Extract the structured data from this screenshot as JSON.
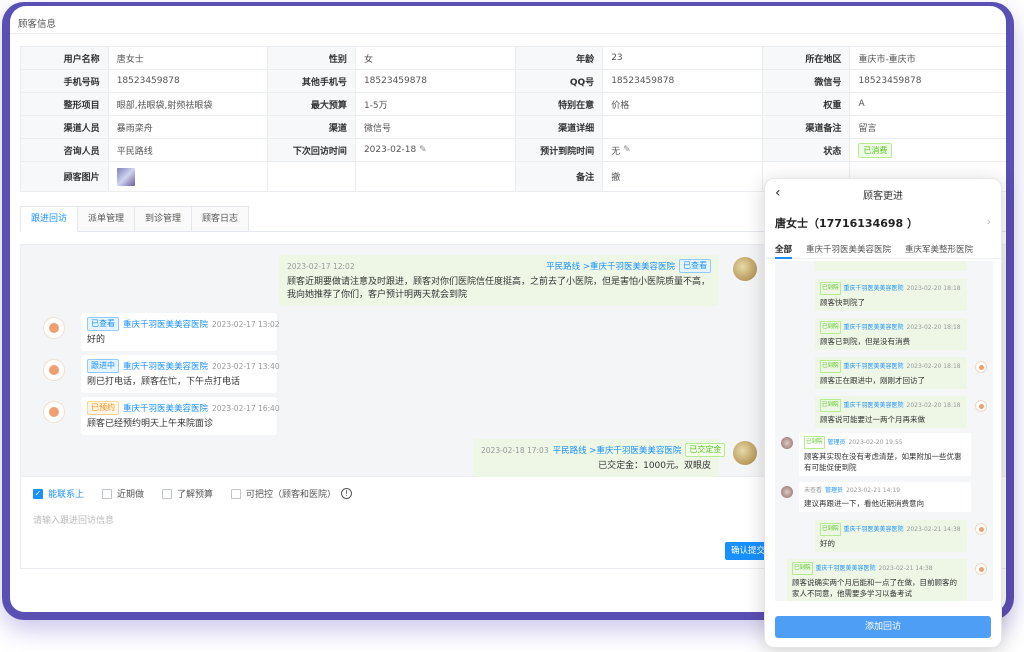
{
  "page_title": "顾客信息",
  "info": {
    "rows": [
      [
        {
          "l": "用户名称",
          "v": "唐女士"
        },
        {
          "l": "性别",
          "v": "女"
        },
        {
          "l": "年龄",
          "v": "23"
        },
        {
          "l": "所在地区",
          "v": "重庆市-重庆市"
        }
      ],
      [
        {
          "l": "手机号码",
          "v": "18523459878"
        },
        {
          "l": "其他手机号",
          "v": "18523459878"
        },
        {
          "l": "QQ号",
          "v": "18523459878"
        },
        {
          "l": "微信号",
          "v": "18523459878"
        }
      ],
      [
        {
          "l": "整形项目",
          "v": "眼部,祛眼袋,射频祛眼袋"
        },
        {
          "l": "最大预算",
          "v": "1-5万"
        },
        {
          "l": "特别在意",
          "v": "价格"
        },
        {
          "l": "权重",
          "v": "A"
        }
      ],
      [
        {
          "l": "渠道人员",
          "v": "暴雨栾舟"
        },
        {
          "l": "渠道",
          "v": "微信号"
        },
        {
          "l": "渠道详细",
          "v": ""
        },
        {
          "l": "渠道备注",
          "v": "留言"
        }
      ],
      [
        {
          "l": "咨询人员",
          "v": "平民路线"
        },
        {
          "l": "下次回访时间",
          "v": "2023-02-18"
        },
        {
          "l": "预计到院时间",
          "v": "无"
        },
        {
          "l": "状态",
          "v": "已消费"
        }
      ],
      [
        {
          "l": "顾客图片",
          "v": ""
        },
        {
          "l": "",
          "v": ""
        },
        {
          "l": "备注",
          "v": "撤"
        },
        {
          "l": "",
          "v": ""
        }
      ]
    ]
  },
  "tabs": [
    "跟进回访",
    "派单管理",
    "到诊管理",
    "顾客日志"
  ],
  "chat": {
    "m1": {
      "time": "2023-02-17 12:02",
      "from": "平民路线 >重庆千羽医美美容医院",
      "badge": "已查看",
      "text": "顾客近期要做请注意及时跟进，顾客对你们医院信任度挺高，之前去了小医院，但是害怕小医院质量不高，我向她推荐了你们，客户预计明两天就会到院"
    },
    "m2": {
      "badge": "已查看",
      "org": "重庆千羽医美美容医院",
      "time": "2023-02-17 13:02",
      "text": "好的"
    },
    "m3": {
      "badge": "跟进中",
      "org": "重庆千羽医美美容医院",
      "time": "2023-02-17 13:40",
      "text": "刚已打电话，顾客在忙，下午点打电话"
    },
    "m4": {
      "badge": "已预约",
      "org": "重庆千羽医美美容医院",
      "time": "2023-02-17 16:40",
      "text": "顾客已经预约明天上午来院面诊"
    },
    "m5": {
      "time": "2023-02-18 17:03",
      "from": "平民路线 >重庆千羽医美美容医院",
      "badge": "已交定金",
      "text": "已交定金：1000元。双眼皮"
    }
  },
  "checks": [
    {
      "label": "能联系上",
      "on": true
    },
    {
      "label": "近期做",
      "on": false
    },
    {
      "label": "了解预算",
      "on": false
    },
    {
      "label": "可把控（顾客和医院）",
      "on": false
    }
  ],
  "compose": {
    "placeholder": "请输入跟进回访信息",
    "submit": "确认提交"
  },
  "phone": {
    "title": "顾客更进",
    "name": "唐女士（17716134698 ）",
    "tabs": [
      "全部",
      "重庆千羽医美美容医院",
      "重庆军美整形医院"
    ],
    "items": [
      {
        "g": "已到院",
        "o": "重庆千羽医美美容医院",
        "t": "2023-02-20 18:18",
        "x": "顾客快到院了"
      },
      {
        "g": "已到院",
        "o": "重庆千羽医美美容医院",
        "t": "2023-02-20 18:18",
        "x": "顾客已到院，但是没有消费"
      },
      {
        "g": "已到院",
        "o": "重庆千羽医美美容医院",
        "t": "2023-02-20 18:18",
        "x": "顾客正在跟进中，刚刚才回访了"
      },
      {
        "g": "已到院",
        "o": "重庆千羽医美美容医院",
        "t": "2023-02-20 18:18",
        "x": "顾客说可能要过一两个月再来做"
      },
      {
        "g": "已到院",
        "o": "管理员",
        "t": "2023-02-20 19:55",
        "x": "顾客其实现在没有考虑清楚，如果附加一些优惠有可能促使到院"
      },
      {
        "g": "未查看",
        "o": "管理员",
        "t": "2023-02-21 14:19",
        "x": "建议再跟进一下，看他近期消费意向"
      },
      {
        "g": "已到院",
        "o": "重庆千羽医美美容医院",
        "t": "2023-02-21 14:38",
        "x": "好的"
      },
      {
        "g": "已到院",
        "o": "重庆千羽医美美容医院",
        "t": "2023-02-21 14:38",
        "x": "顾客说确实两个月后能和一点了在做，目前顾客的家人不同意，他需要多学习以备考试"
      }
    ],
    "button": "添加回访"
  },
  "icons": {
    "edit": "edit-pencil-icon",
    "back": "chevron-left-icon",
    "info": "info-circle-icon"
  }
}
